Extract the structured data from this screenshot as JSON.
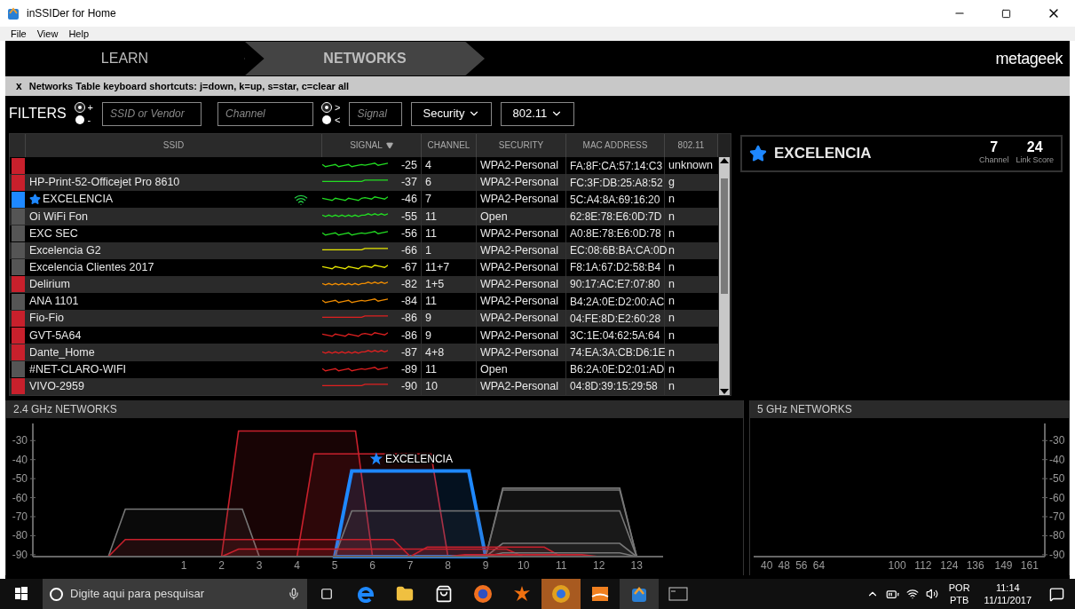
{
  "window": {
    "title": "inSSIDer for Home"
  },
  "menu": [
    "File",
    "View",
    "Help"
  ],
  "nav_tabs": [
    {
      "label": "LEARN",
      "selected": false
    },
    {
      "label": "NETWORKS",
      "selected": true
    }
  ],
  "brand": "metageek",
  "shortcut_bar": {
    "close": "x",
    "text": "Networks Table keyboard shortcuts: j=down, k=up, s=star, c=clear all"
  },
  "filters": {
    "label": "FILTERS",
    "include_options": [
      {
        "label": "+",
        "selected": true
      },
      {
        "label": "-",
        "selected": false
      }
    ],
    "ssid_placeholder": "SSID or Vendor",
    "channel_placeholder": "Channel",
    "signal_options": [
      {
        "label": ">",
        "selected": true
      },
      {
        "label": "<",
        "selected": false
      }
    ],
    "signal_placeholder": "Signal",
    "dropdowns": [
      "Security",
      "802.11"
    ]
  },
  "table": {
    "columns": [
      {
        "label": "SSID",
        "sorted": false
      },
      {
        "label": "SIGNAL",
        "sorted": true
      },
      {
        "label": "CHANNEL",
        "sorted": false
      },
      {
        "label": "SECURITY",
        "sorted": false
      },
      {
        "label": "MAC ADDRESS",
        "sorted": false
      },
      {
        "label": "802.11",
        "sorted": false
      }
    ],
    "rows": [
      {
        "color": "#c8202c",
        "starred": false,
        "connected": false,
        "signal": "-25",
        "channel": "4",
        "security": "WPA2-Personal",
        "mac": "FA:8F:CA:57:14:C3",
        "standard": "unknown"
      },
      {
        "color": "#c8202c",
        "ssid": "HP-Print-52-Officejet Pro 8610",
        "starred": false,
        "connected": false,
        "signal": "-37",
        "channel": "6",
        "security": "WPA2-Personal",
        "mac": "FC:3F:DB:25:A8:52",
        "standard": "g"
      },
      {
        "color": "#1e88ff",
        "ssid": "EXCELENCIA",
        "starred": true,
        "connected": true,
        "signal": "-46",
        "channel": "7",
        "security": "WPA2-Personal",
        "mac": "5C:A4:8A:69:16:20",
        "standard": "n"
      },
      {
        "color": "#555555",
        "ssid": "Oi WiFi Fon",
        "starred": false,
        "connected": false,
        "signal": "-55",
        "channel": "11",
        "security": "Open",
        "mac": "62:8E:78:E6:0D:7D",
        "standard": "n"
      },
      {
        "color": "#555555",
        "ssid": "EXC SEC",
        "starred": false,
        "connected": false,
        "signal": "-56",
        "channel": "11",
        "security": "WPA2-Personal",
        "mac": "A0:8E:78:E6:0D:78",
        "standard": "n"
      },
      {
        "color": "#555555",
        "ssid": "Excelencia G2",
        "starred": false,
        "connected": false,
        "signal": "-66",
        "channel": "1",
        "security": "WPA2-Personal",
        "mac": "EC:08:6B:BA:CA:0D",
        "standard": "n"
      },
      {
        "color": "#555555",
        "ssid": "Excelencia Clientes 2017",
        "starred": false,
        "connected": false,
        "signal": "-67",
        "channel": "11+7",
        "security": "WPA2-Personal",
        "mac": "F8:1A:67:D2:58:B4",
        "standard": "n"
      },
      {
        "color": "#c8202c",
        "ssid": "Delirium",
        "starred": false,
        "connected": false,
        "signal": "-82",
        "channel": "1+5",
        "security": "WPA2-Personal",
        "mac": "90:17:AC:E7:07:80",
        "standard": "n"
      },
      {
        "color": "#555555",
        "ssid": "ANA 1101",
        "starred": false,
        "connected": false,
        "signal": "-84",
        "channel": "11",
        "security": "WPA2-Personal",
        "mac": "B4:2A:0E:D2:00:AC",
        "standard": "n"
      },
      {
        "color": "#c8202c",
        "ssid": "Fio-Fio",
        "starred": false,
        "connected": false,
        "signal": "-86",
        "channel": "9",
        "security": "WPA2-Personal",
        "mac": "04:FE:8D:E2:60:28",
        "standard": "n"
      },
      {
        "color": "#c8202c",
        "ssid": "GVT-5A64",
        "starred": false,
        "connected": false,
        "signal": "-86",
        "channel": "9",
        "security": "WPA2-Personal",
        "mac": "3C:1E:04:62:5A:64",
        "standard": "n"
      },
      {
        "color": "#c8202c",
        "ssid": "Dante_Home",
        "starred": false,
        "connected": false,
        "signal": "-87",
        "channel": "4+8",
        "security": "WPA2-Personal",
        "mac": "74:EA:3A:CB:D6:1E",
        "standard": "n"
      },
      {
        "color": "#555555",
        "ssid": "#NET-CLARO-WIFI",
        "starred": false,
        "connected": false,
        "signal": "-89",
        "channel": "11",
        "security": "Open",
        "mac": "B6:2A:0E:D2:01:AD",
        "standard": "n"
      },
      {
        "color": "#c8202c",
        "ssid": "VIVO-2959",
        "starred": false,
        "connected": false,
        "signal": "-90",
        "channel": "10",
        "security": "WPA2-Personal",
        "mac": "04:8D:39:15:29:58",
        "standard": "n"
      }
    ]
  },
  "detail": {
    "ssid": "EXCELENCIA",
    "starred": true,
    "channel": "7",
    "channel_label": "Channel",
    "link_score": "24",
    "link_score_label": "Link Score"
  },
  "charts": [
    {
      "title": "2.4 GHz NETWORKS",
      "starred_label": "EXCELENCIA",
      "chart_data": {
        "type": "area",
        "xlim": [
          -3,
          13.7
        ],
        "ylim": [
          -91,
          -21
        ],
        "xticks": [
          1,
          2,
          3,
          4,
          5,
          6,
          7,
          8,
          9,
          10,
          11,
          12,
          13
        ],
        "yticks": [
          -30,
          -40,
          -50,
          -60,
          -70,
          -80,
          -90
        ]
      }
    },
    {
      "title": "5 GHz NETWORKS",
      "chart_data": {
        "type": "area",
        "xlim": [
          34,
          168
        ],
        "ylim": [
          -91,
          -21
        ],
        "xticks": [
          40,
          48,
          56,
          64,
          100,
          112,
          124,
          136,
          149,
          161
        ],
        "yticks": [
          -30,
          -40,
          -50,
          -60,
          -70,
          -80,
          -90
        ]
      }
    }
  ],
  "taskbar": {
    "search_placeholder": "Digite aqui para pesquisar",
    "language": "POR",
    "layout": "PTB",
    "time": "11:14",
    "date": "11/11/2017"
  }
}
